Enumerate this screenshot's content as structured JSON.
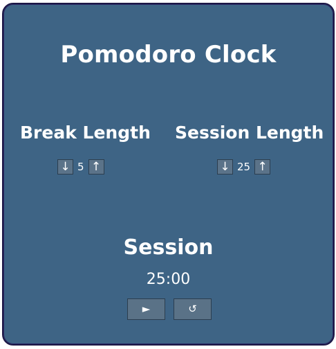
{
  "app": {
    "title": "Pomodoro Clock"
  },
  "break": {
    "label": "Break Length",
    "decrement": "↓",
    "value": "5",
    "increment": "↑"
  },
  "session": {
    "label": "Session Length",
    "decrement": "↓",
    "value": "25",
    "increment": "↑"
  },
  "timer": {
    "label": "Session",
    "time_left": "25:00",
    "start_stop": "►",
    "reset": "↺"
  },
  "colors": {
    "panel_bg": "#3e6485",
    "panel_border": "#1c1745",
    "button_bg": "#5a7287",
    "text": "#ffffff"
  }
}
